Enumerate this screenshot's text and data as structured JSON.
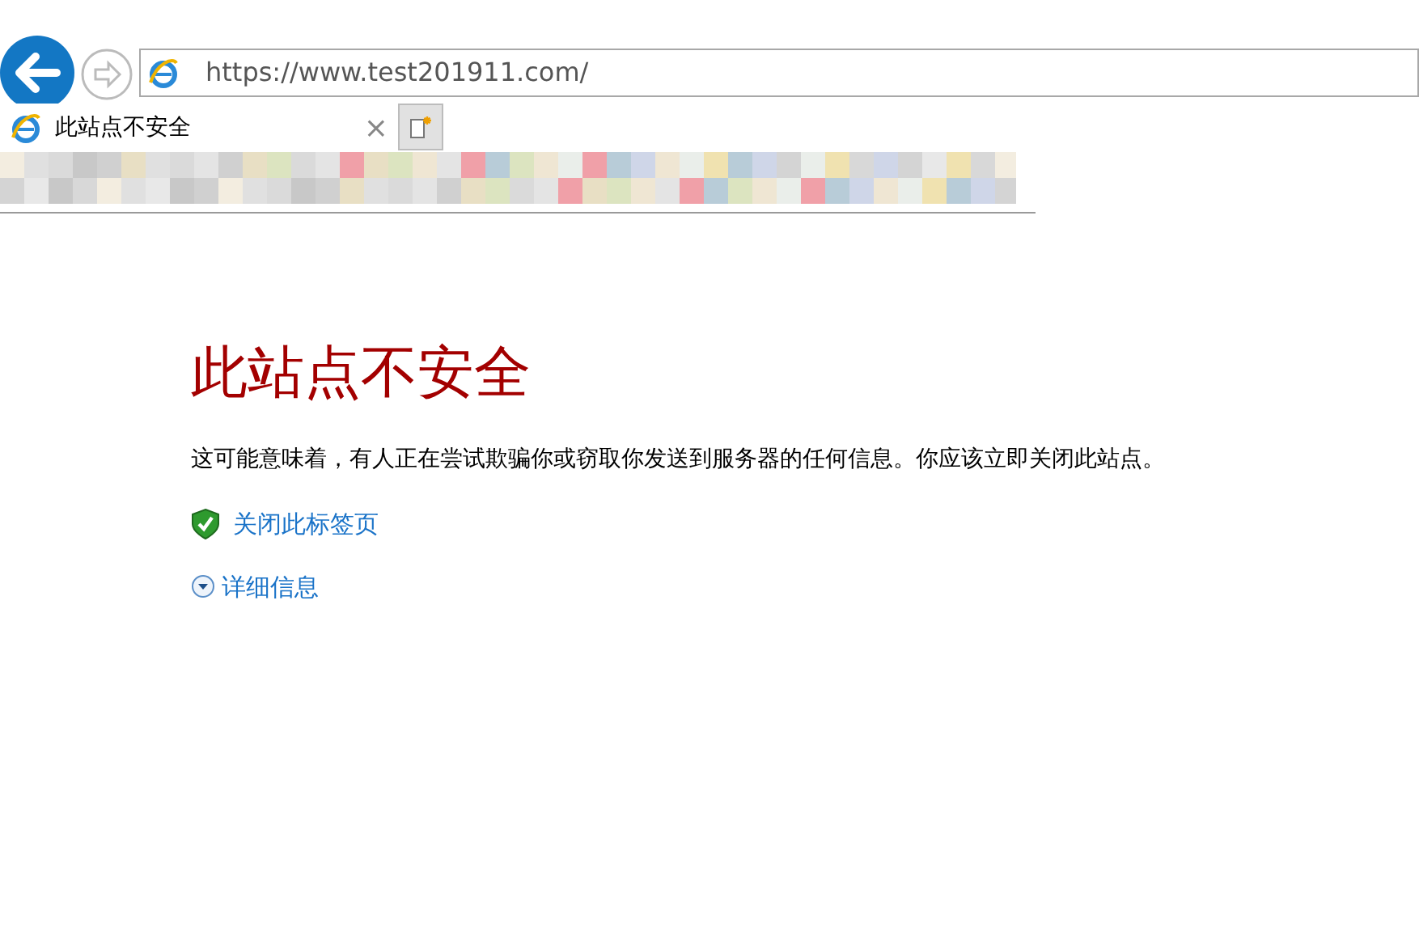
{
  "address_bar": {
    "url": "https://www.test201911.com/"
  },
  "tabs": [
    {
      "title": "此站点不安全",
      "close": "×",
      "selected": true
    }
  ],
  "page": {
    "heading": "此站点不安全",
    "message": "这可能意味着，有人正在尝试欺骗你或窃取你发送到服务器的任何信息。你应该立即关闭此站点。",
    "links": [
      {
        "kind": "shield",
        "label": "关闭此标签页"
      },
      {
        "kind": "expand",
        "label": "详细信息"
      }
    ]
  }
}
